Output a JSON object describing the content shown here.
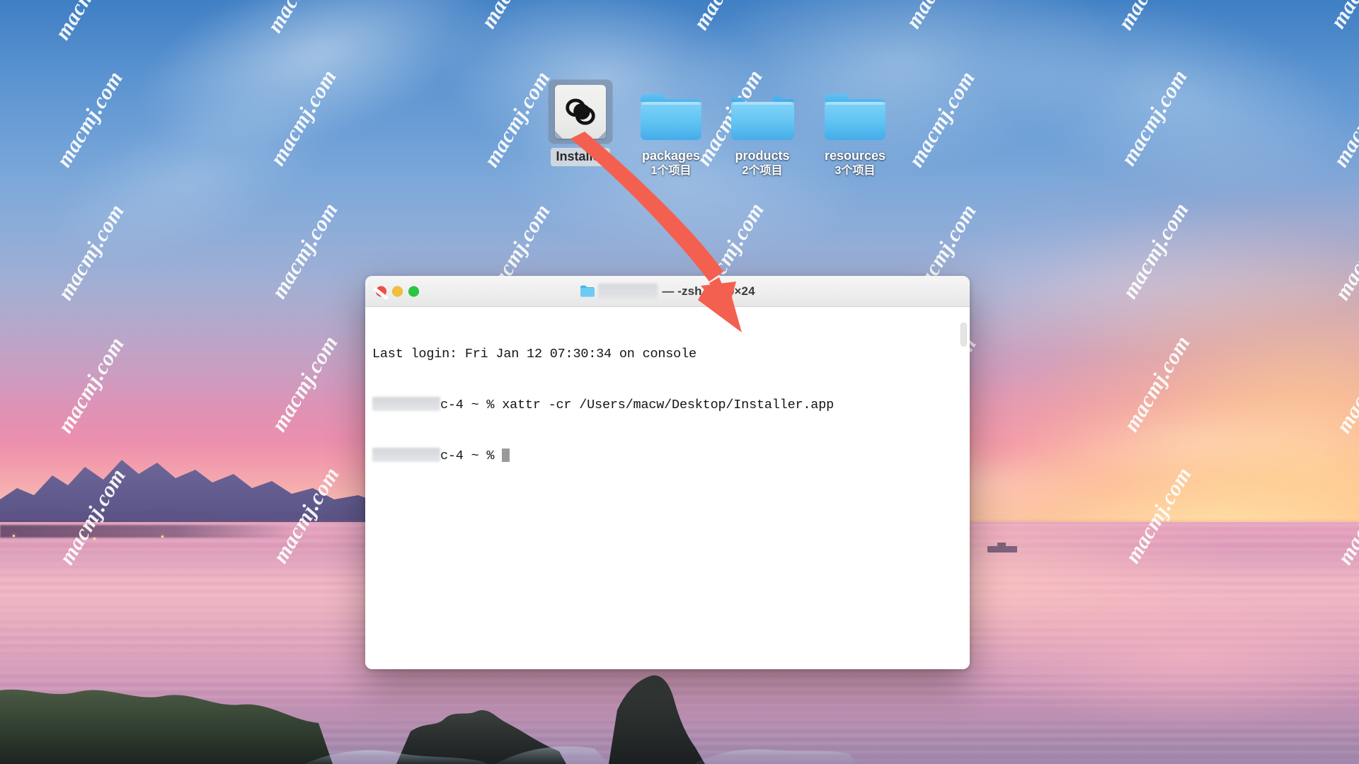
{
  "desktop": {
    "wallpaper_description": "sunset seascape with mountains and rocks",
    "watermark_text": "macmj.com",
    "icons": [
      {
        "name": "Installer",
        "label": "Installer",
        "sublabel": "",
        "type": "application",
        "icon": "adobe-creative-cloud-icon",
        "selected": true
      },
      {
        "name": "packages",
        "label": "packages",
        "sublabel": "1个项目",
        "type": "folder",
        "icon": "folder-icon",
        "selected": false
      },
      {
        "name": "products",
        "label": "products",
        "sublabel": "2个项目",
        "type": "folder-open",
        "icon": "folder-open-icon",
        "selected": false
      },
      {
        "name": "resources",
        "label": "resources",
        "sublabel": "3个项目",
        "type": "folder",
        "icon": "folder-icon",
        "selected": false
      }
    ]
  },
  "terminal": {
    "title": {
      "redacted_user": "",
      "suffix": "— -zsh — 80×24",
      "folder_icon": "folder-icon"
    },
    "traffic_lights": {
      "close": "close-button",
      "minimize": "minimize-button",
      "zoom": "zoom-button",
      "close_color": "#ef4f45",
      "minimize_color": "#f3be3b",
      "zoom_color": "#28c83f"
    },
    "lines": [
      {
        "id": "login",
        "text": "Last login: Fri Jan 12 07:30:34 on console"
      },
      {
        "id": "cmd",
        "prefix_redacted": true,
        "host": "c-4 ~ % ",
        "text": "xattr -cr /Users/macw/Desktop/Installer.app"
      },
      {
        "id": "prompt",
        "prefix_redacted": true,
        "host": "c-4 ~ % ",
        "text": ""
      }
    ]
  },
  "annotation": {
    "type": "arrow",
    "color": "#f4604f",
    "from": "Installer desktop icon",
    "to": "Installer.app path in terminal command"
  }
}
